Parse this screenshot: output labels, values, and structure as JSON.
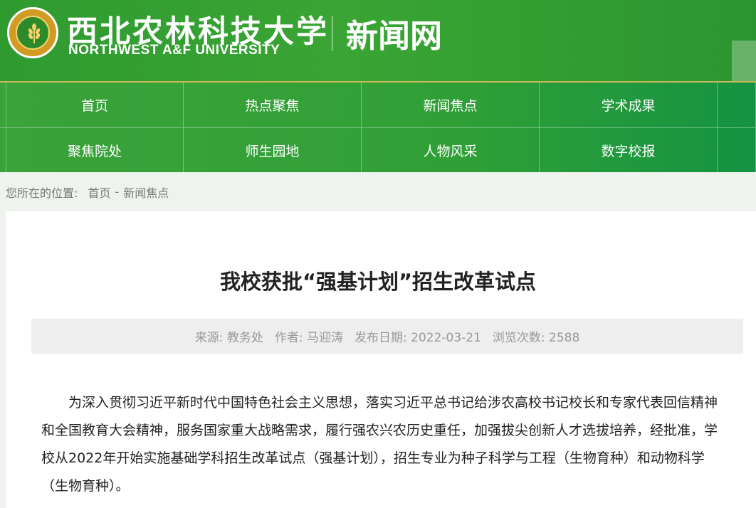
{
  "header": {
    "logo_title": "西北农林科技大学",
    "logo_en": "NORTHWEST A&F UNIVERSITY",
    "site_name": "新闻网",
    "colors": {
      "primary_green": "#34a236",
      "seal_gold": "#d19a22",
      "divider": "#c9b95a"
    }
  },
  "nav": {
    "row1": [
      "首页",
      "热点聚焦",
      "新闻焦点",
      "学术成果"
    ],
    "row2": [
      "聚焦院处",
      "师生园地",
      "人物风采",
      "数字校报"
    ]
  },
  "breadcrumb": {
    "lead": "您所在的位置:",
    "home": "首页",
    "separator": "-",
    "current": "新闻焦点"
  },
  "article": {
    "title": "我校获批“强基计划”招生改革试点",
    "meta": {
      "source": "来源: 教务处",
      "author": "作者: 马迎涛",
      "date": "发布日期: 2022-03-21",
      "views": "浏览次数: 2588"
    },
    "paragraph": "为深入贯彻习近平新时代中国特色社会主义思想，落实习近平总书记给涉农高校书记校长和专家代表回信精神和全国教育大会精神，服务国家重大战略需求，履行强农兴农历史重任，加强拔尖创新人才选拔培养，经批准，学校从2022年开始实施基础学科招生改革试点（强基计划），招生专业为种子科学与工程（生物育种）和动物科学（生物育种）。"
  }
}
